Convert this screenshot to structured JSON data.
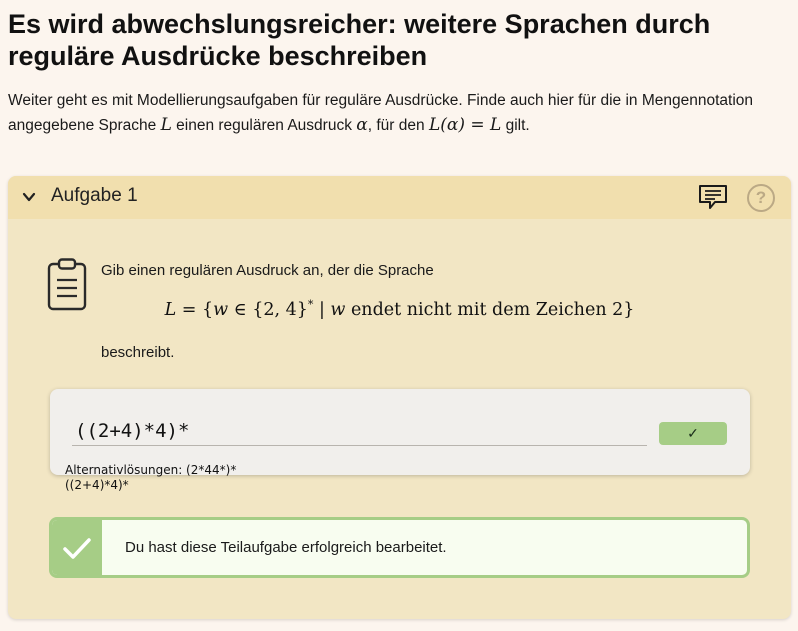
{
  "page": {
    "title": "Es wird abwechslungsreicher: weitere Sprachen durch reguläre Ausdrücke beschreiben",
    "intro_part1": "Weiter geht es mit Modellierungsaufgaben für reguläre Ausdrücke. Finde auch hier für die in Mengennotation angegebene Sprache ",
    "intro_var_L": "L",
    "intro_part2": " einen regulären Ausdruck ",
    "intro_var_alpha": "α",
    "intro_part3": ", für den ",
    "intro_formula": "L(α) = L",
    "intro_part4": " gilt."
  },
  "task": {
    "header_title": "Aufgabe 1",
    "icons": {
      "toggle": "chevron-down-icon",
      "feedback": "feedback-chat-icon",
      "help": "help-icon",
      "task": "clipboard-icon",
      "success": "checkmark-icon"
    },
    "help_symbol": "?",
    "instruction": "Gib einen regulären Ausdruck an, der die Sprache",
    "formula": {
      "lhs": "L",
      "eq": " = {",
      "w": "w",
      "in": " ∈ {2, 4}",
      "star": "*",
      "sep": " | ",
      "w2": "w",
      "rest": " endet nicht mit dem Zeichen 2}"
    },
    "instruction_end": "beschreibt.",
    "answer_value": "((2+4)*4)*",
    "check_label": "✓",
    "alt_solutions_line1": "Alternativlösungen: (2*44*)*",
    "alt_solutions_line2": "((2+4)*4)*",
    "success_message": "Du hast diese Teilaufgabe erfolgreich bearbeitet."
  },
  "colors": {
    "background": "#fcf5ee",
    "card": "#f2e6c4",
    "card_header": "#f1dfae",
    "success_green": "#a6cd86"
  }
}
